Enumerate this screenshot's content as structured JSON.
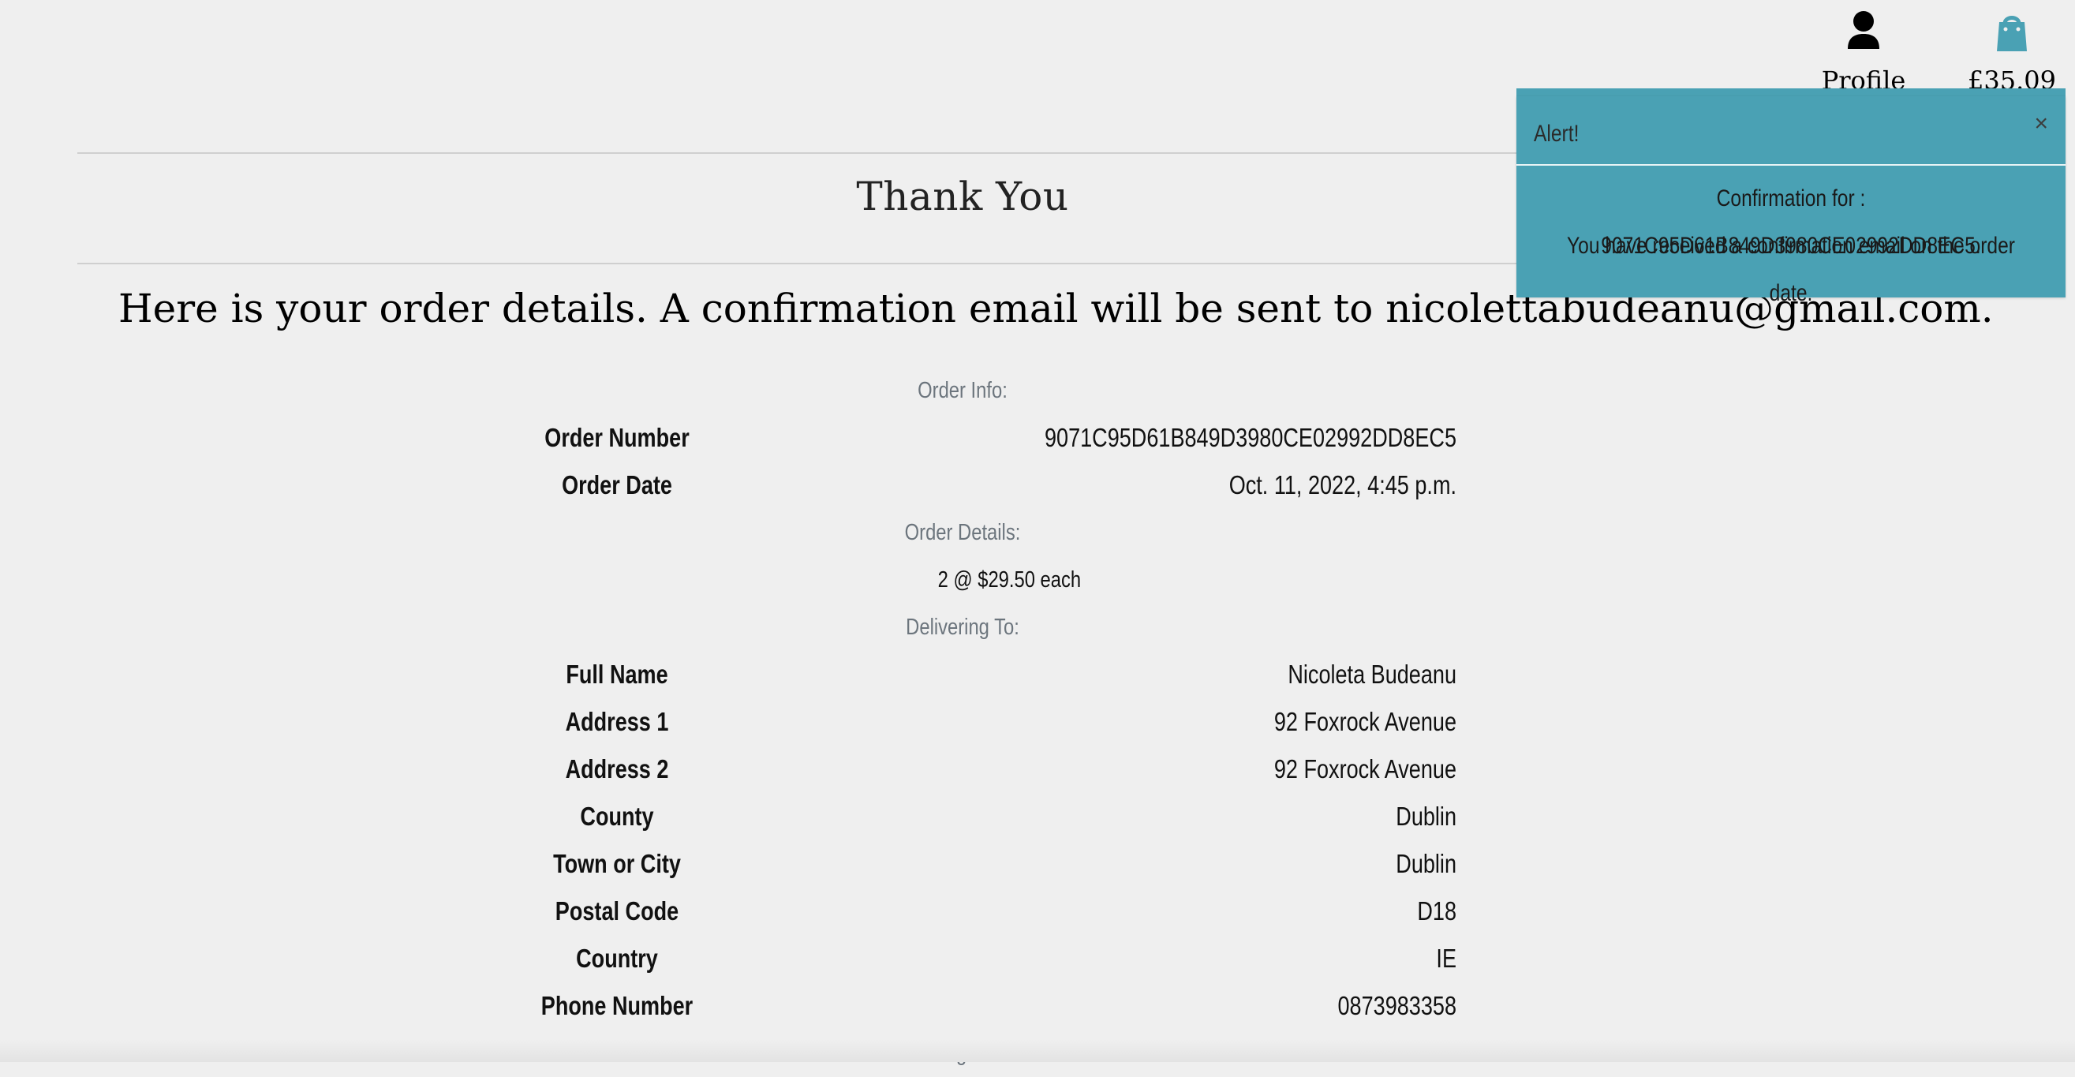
{
  "nav": {
    "profile_label": "Profile",
    "bag_total": "£35.09",
    "profile_icon": "user-icon",
    "bag_icon": "shopping-bag-icon",
    "accent": "#4aa1b4"
  },
  "page": {
    "title": "Thank You",
    "intro": "Here is your order details. A confirmation email will be sent to nicolettabudeanu@gmail.com."
  },
  "order_info": {
    "heading": "Order Info:",
    "rows": [
      {
        "label": "Order Number",
        "value": "9071C95D61B849D3980CE02992DD8EC5"
      },
      {
        "label": "Order Date",
        "value": "Oct. 11, 2022, 4:45 p.m."
      }
    ]
  },
  "order_details": {
    "heading": "Order Details:",
    "item_line": "2 @ $29.50 each"
  },
  "delivering_to": {
    "heading": "Delivering To:",
    "rows": [
      {
        "label": "Full Name",
        "value": "Nicoleta Budeanu"
      },
      {
        "label": "Address 1",
        "value": "92 Foxrock Avenue"
      },
      {
        "label": "Address 2",
        "value": "92 Foxrock Avenue"
      },
      {
        "label": "County",
        "value": "Dublin"
      },
      {
        "label": "Town or City",
        "value": "Dublin"
      },
      {
        "label": "Postal Code",
        "value": "D18"
      },
      {
        "label": "Country",
        "value": "IE"
      },
      {
        "label": "Phone Number",
        "value": "0873983358"
      }
    ]
  },
  "billing_info": {
    "heading": "Billing Info:"
  },
  "toast": {
    "title": "Alert!",
    "close": "×",
    "line1": "Confirmation for : 9071C95D61B849D3980CE02992DD8EC5.",
    "line2": "You have received a confirmation email on the order date.",
    "color": "#4aa1b4"
  }
}
